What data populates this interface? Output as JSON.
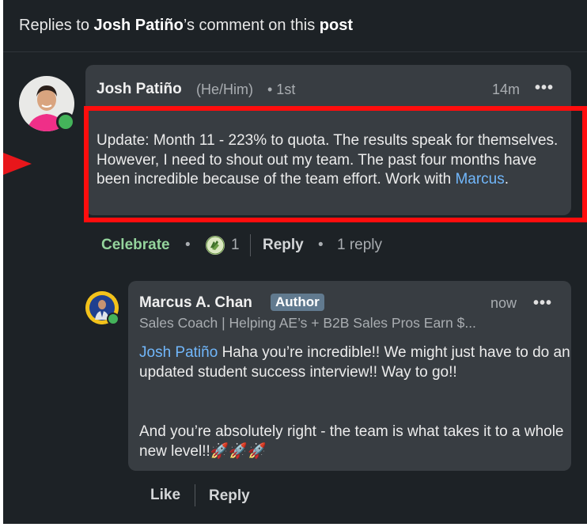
{
  "header": {
    "prefix": "Replies to ",
    "author": "Josh Patiño",
    "middle": "’s comment on this ",
    "post": "post"
  },
  "comment": {
    "name": "Josh Patiño",
    "pronouns": "(He/Him)",
    "degree": "• 1st",
    "time": "14m",
    "more": "•••",
    "body_part1": "Update: Month 11 - 223% to quota. The results speak for themselves. However, I need to shout out my team. The past four months have been incredible because of the team effort. Work with ",
    "body_mention": "Marcus",
    "body_end": ".",
    "actions": {
      "celebrate": "Celebrate",
      "dot": "•",
      "reaction_count": "1",
      "reply": "Reply",
      "reply_count": "1 reply"
    }
  },
  "reply": {
    "name": "Marcus A. Chan",
    "badge": "Author",
    "headline": "Sales Coach | Helping AE’s + B2B Sales Pros Earn $...",
    "time": "now",
    "more": "•••",
    "mention": "Josh Patiño",
    "body_part1": " Haha you’re incredible!! We might just have to do an updated student success interview!! Way to go!!",
    "body_part2": "And you’re absolutely right - the team is what takes it to a whole new level!!🚀🚀🚀",
    "actions": {
      "like": "Like",
      "reply": "Reply"
    }
  },
  "colors": {
    "background": "#1d2226",
    "bubble": "#383d42",
    "link": "#71b7fb",
    "celebrate": "#94d49c",
    "highlight": "#ff0d0d",
    "presence": "#44b35a"
  }
}
